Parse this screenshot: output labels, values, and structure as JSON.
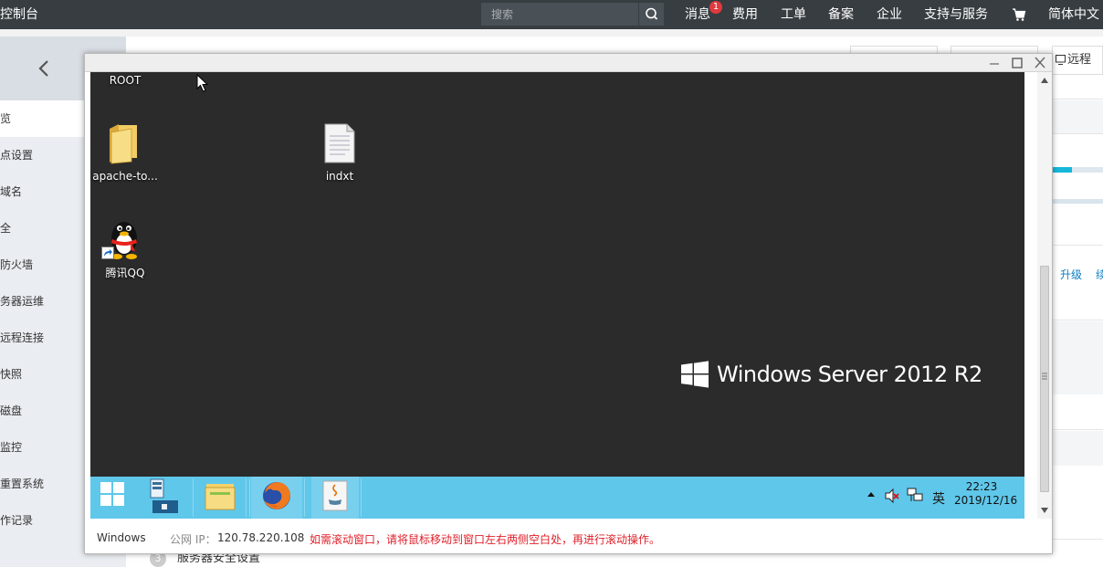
{
  "topbar": {
    "brand": "控制台",
    "search_placeholder": "搜索",
    "nav": {
      "messages": "消息",
      "message_count": "1",
      "billing": "费用",
      "tickets": "工单",
      "filing": "备案",
      "enterprise": "企业",
      "support": "支持与服务",
      "language": "简体中文"
    }
  },
  "sidebar": {
    "items": [
      "览",
      "点设置",
      "域名",
      "全",
      "防火墙",
      "务器运维",
      "远程连接",
      "快照",
      "磁盘",
      "监控",
      "重置系统",
      "作记录"
    ]
  },
  "main": {
    "remote_button": "远程",
    "upgrade_link": "升级",
    "other_link": "续",
    "step_number": "3",
    "step_label": "服务器安全设置",
    "progress_percent": 40
  },
  "remote_window": {
    "desktop": {
      "icons": {
        "root": "ROOT",
        "apache": "apache-to...",
        "indxt": "indxt",
        "qq": "腾讯QQ"
      },
      "branding": "Windows Server 2012 R2"
    },
    "taskbar": {
      "ime": "英",
      "time": "22:23",
      "date": "2019/12/16"
    },
    "status": {
      "os": "Windows",
      "ip_label": "公网 IP：",
      "ip": "120.78.220.108",
      "warning": "如需滚动窗口，请将鼠标移动到窗口左右两侧空白处，再进行滚动操作。"
    }
  },
  "colors": {
    "topbar": "#373d41",
    "desktop": "#2b2b2b",
    "taskbar": "#5fc7ea",
    "warning": "#e0202a",
    "link": "#0a7ec2"
  }
}
